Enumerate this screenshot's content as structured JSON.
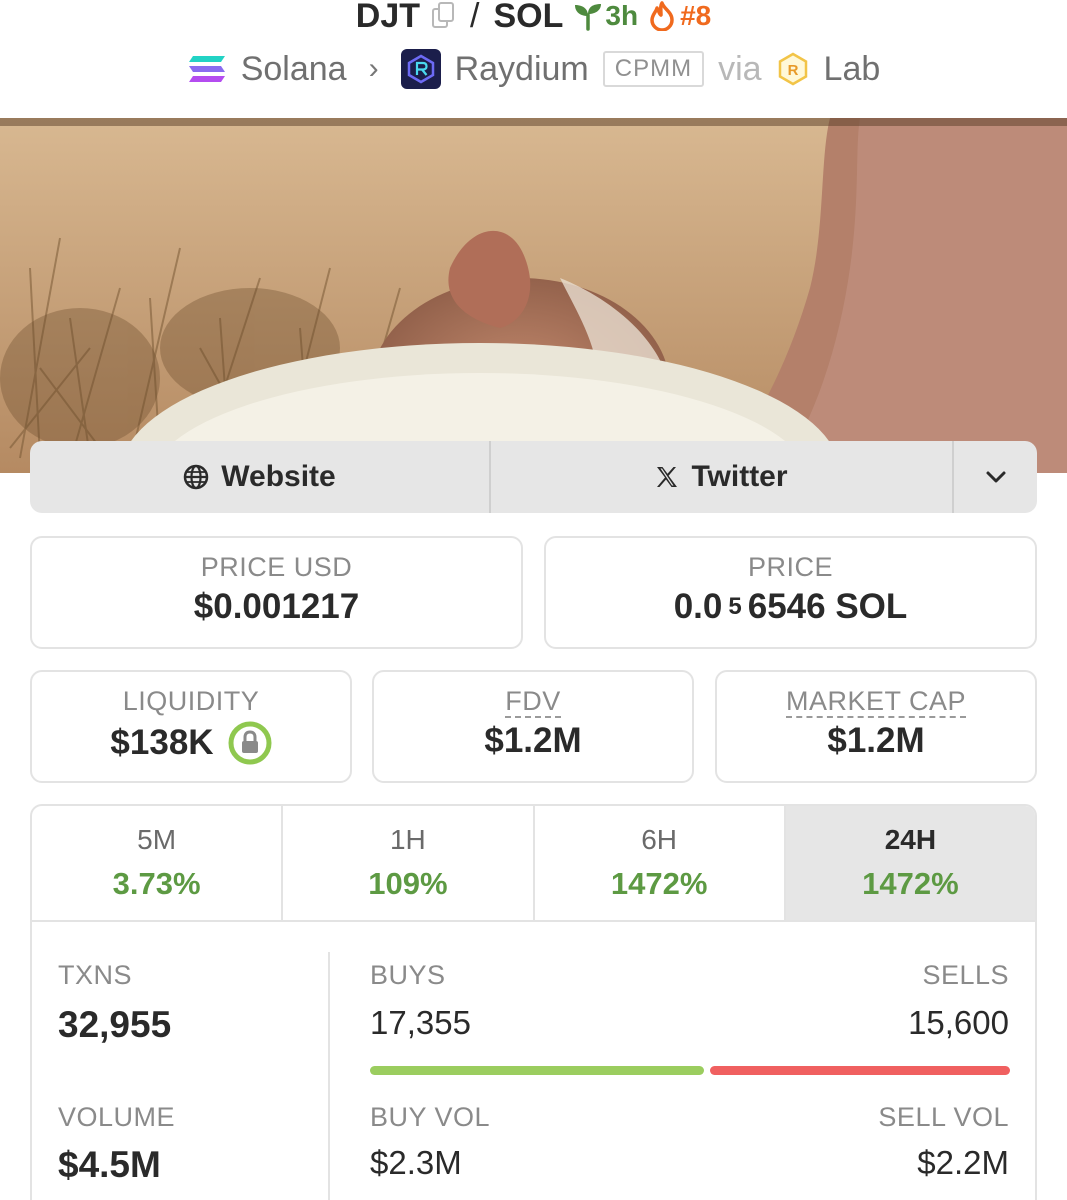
{
  "header": {
    "token": "DJT",
    "quote": "SOL",
    "slash": "/",
    "age": "3h",
    "rank": "#8",
    "chain": "Solana",
    "dex": "Raydium",
    "pool_type": "CPMM",
    "via": "via",
    "launchpad": "Lab"
  },
  "links": {
    "website": "Website",
    "twitter": "Twitter"
  },
  "stats": {
    "price_usd_label": "PRICE USD",
    "price_usd": "$0.001217",
    "price_label": "PRICE",
    "price_prefix": "0.0",
    "price_sub": "5",
    "price_suffix": "6546 SOL",
    "liquidity_label": "LIQUIDITY",
    "liquidity": "$138K",
    "fdv_label": "FDV",
    "fdv": "$1.2M",
    "mcap_label": "MARKET CAP",
    "mcap": "$1.2M"
  },
  "timeframes": [
    {
      "label": "5M",
      "change": "3.73%"
    },
    {
      "label": "1H",
      "change": "109%"
    },
    {
      "label": "6H",
      "change": "1472%"
    },
    {
      "label": "24H",
      "change": "1472%"
    }
  ],
  "active_timeframe": "24H",
  "metrics": {
    "txns_label": "TXNS",
    "txns": "32,955",
    "buys_label": "BUYS",
    "buys": "17,355",
    "sells_label": "SELLS",
    "sells": "15,600",
    "buy_share": 0.527,
    "volume_label": "VOLUME",
    "volume": "$4.5M",
    "buy_vol_label": "BUY VOL",
    "buy_vol": "$2.3M",
    "sell_vol_label": "SELL VOL",
    "sell_vol": "$2.2M",
    "buy_vol_share": 0.51
  },
  "colors": {
    "positive": "#5d9a43",
    "buy_bar": "#9bcd5f",
    "sell_bar": "#f06060",
    "age_green": "#4e8a3e",
    "rank_orange": "#f06a1e"
  }
}
